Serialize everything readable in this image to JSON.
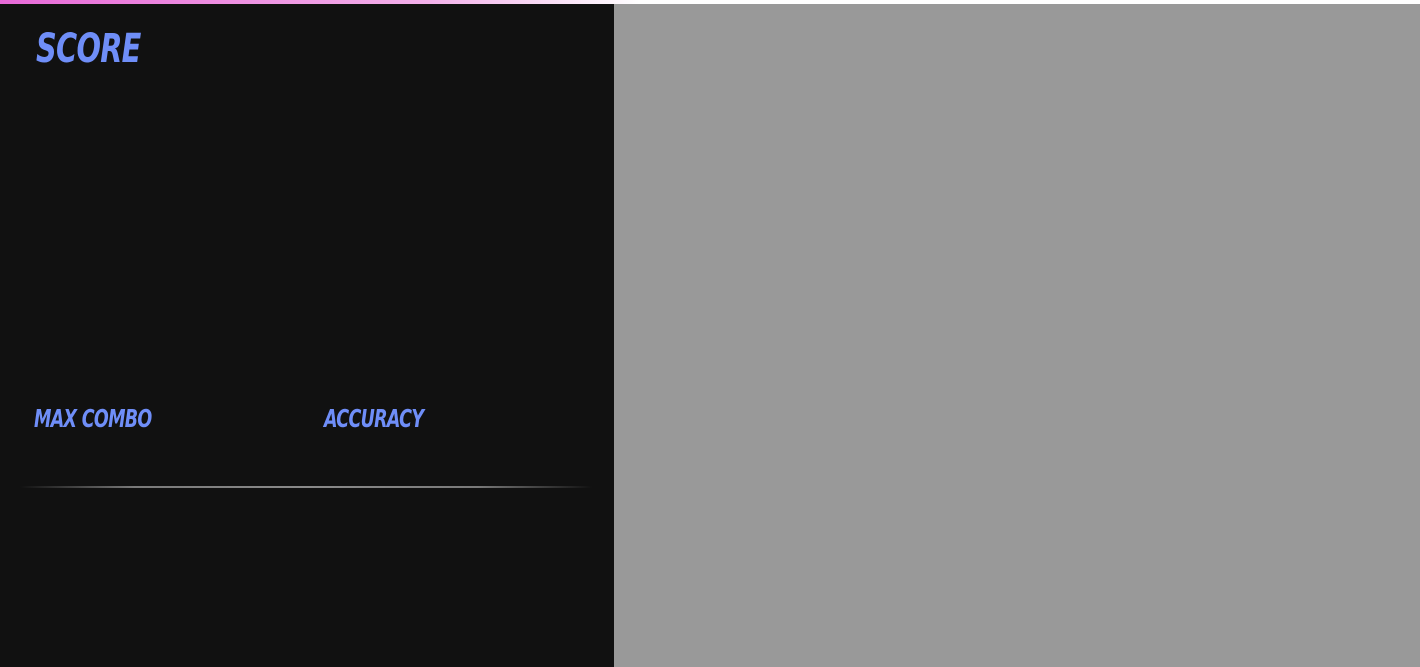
{
  "results": {
    "score_label": "SCORE",
    "score_value": "",
    "max_combo_label": "MAX COMBO",
    "max_combo_value": "",
    "accuracy_label": "ACCURACY",
    "accuracy_value": ""
  },
  "colors": {
    "accent_label": "#6f8ef8",
    "panel_background": "#111111",
    "preview_background": "#999999",
    "top_bar_gradient_start": "#e86ad8"
  }
}
